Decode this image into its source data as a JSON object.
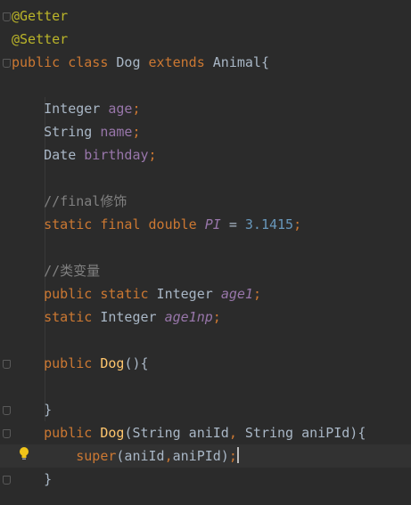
{
  "editor": {
    "lines": [
      [
        {
          "t": "@Getter",
          "c": "an"
        }
      ],
      [
        {
          "t": "@Setter",
          "c": "an"
        }
      ],
      [
        {
          "t": "public",
          "c": "kw"
        },
        {
          "t": " "
        },
        {
          "t": "class",
          "c": "kw"
        },
        {
          "t": " Dog "
        },
        {
          "t": "extends",
          "c": "kw"
        },
        {
          "t": " Animal{"
        }
      ],
      [],
      [
        {
          "t": "    Integer "
        },
        {
          "t": "age",
          "c": "fld"
        },
        {
          "t": ";",
          "c": "kw"
        }
      ],
      [
        {
          "t": "    String "
        },
        {
          "t": "name",
          "c": "fld"
        },
        {
          "t": ";",
          "c": "kw"
        }
      ],
      [
        {
          "t": "    Date "
        },
        {
          "t": "birthday",
          "c": "fld"
        },
        {
          "t": ";",
          "c": "kw"
        }
      ],
      [],
      [
        {
          "t": "    //final修饰",
          "c": "cm"
        }
      ],
      [
        {
          "t": "    "
        },
        {
          "t": "static",
          "c": "kw"
        },
        {
          "t": " "
        },
        {
          "t": "final",
          "c": "kw"
        },
        {
          "t": " "
        },
        {
          "t": "double",
          "c": "kw"
        },
        {
          "t": " "
        },
        {
          "t": "PI",
          "c": "sfld"
        },
        {
          "t": " = "
        },
        {
          "t": "3.1415",
          "c": "num"
        },
        {
          "t": ";",
          "c": "kw"
        }
      ],
      [],
      [
        {
          "t": "    //类变量",
          "c": "cm"
        }
      ],
      [
        {
          "t": "    "
        },
        {
          "t": "public",
          "c": "kw"
        },
        {
          "t": " "
        },
        {
          "t": "static",
          "c": "kw"
        },
        {
          "t": " Integer "
        },
        {
          "t": "age1",
          "c": "sfld"
        },
        {
          "t": ";",
          "c": "kw"
        }
      ],
      [
        {
          "t": "    "
        },
        {
          "t": "static",
          "c": "kw"
        },
        {
          "t": " Integer "
        },
        {
          "t": "age1np",
          "c": "sfld"
        },
        {
          "t": ";",
          "c": "kw"
        }
      ],
      [],
      [
        {
          "t": "    "
        },
        {
          "t": "public",
          "c": "kw"
        },
        {
          "t": " "
        },
        {
          "t": "Dog",
          "c": "fn"
        },
        {
          "t": "(){"
        }
      ],
      [],
      [
        {
          "t": "    }"
        }
      ],
      [
        {
          "t": "    "
        },
        {
          "t": "public",
          "c": "kw"
        },
        {
          "t": " "
        },
        {
          "t": "Dog",
          "c": "fn"
        },
        {
          "t": "(String aniId"
        },
        {
          "t": ",",
          "c": "kw"
        },
        {
          "t": " String aniPId){"
        }
      ],
      [
        {
          "t": "        "
        },
        {
          "t": "super",
          "c": "kw"
        },
        {
          "t": "(aniId"
        },
        {
          "t": ",",
          "c": "kw"
        },
        {
          "t": "aniPId)"
        },
        {
          "t": ";",
          "c": "kw"
        }
      ],
      [
        {
          "t": "    }"
        }
      ]
    ],
    "current_line": 19
  },
  "colors": {
    "background": "#2b2b2b",
    "keyword": "#cc7832",
    "annotation": "#bbb529",
    "field": "#9876aa",
    "number": "#6897bb",
    "comment": "#808080",
    "method": "#ffc66d",
    "default_text": "#a9b7c6"
  },
  "icons": [
    "fold-marker-icon",
    "intention-lightbulb-icon",
    "text-caret"
  ]
}
